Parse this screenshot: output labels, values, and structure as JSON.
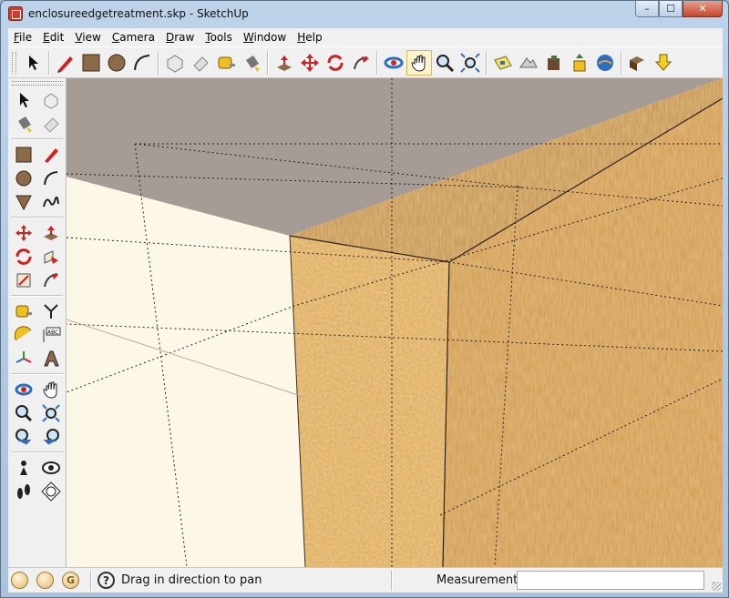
{
  "window": {
    "title": "enclosureedgetreatment.skp - SketchUp",
    "minimize_glyph": "–",
    "maximize_glyph": "☐",
    "close_glyph": "✕"
  },
  "menu": {
    "items": [
      {
        "label": "File",
        "mnemonic": "F"
      },
      {
        "label": "Edit",
        "mnemonic": "E"
      },
      {
        "label": "View",
        "mnemonic": "V"
      },
      {
        "label": "Camera",
        "mnemonic": "C"
      },
      {
        "label": "Draw",
        "mnemonic": "D"
      },
      {
        "label": "Tools",
        "mnemonic": "T"
      },
      {
        "label": "Window",
        "mnemonic": "W"
      },
      {
        "label": "Help",
        "mnemonic": "H"
      }
    ]
  },
  "toolbar": {
    "icons": [
      "select-icon",
      "pencil-line-icon",
      "rectangle-icon",
      "circle-icon",
      "arc-icon",
      "make-component-icon",
      "eraser-icon",
      "tape-measure-icon",
      "paint-bucket-icon",
      "push-pull-icon",
      "move-icon",
      "rotate-icon",
      "follow-me-icon",
      "orbit-icon",
      "pan-icon",
      "zoom-icon",
      "zoom-extents-icon",
      "add-location-icon",
      "toggle-terrain-icon",
      "get-models-icon",
      "share-model-icon",
      "google-earth-icon",
      "components-icon",
      "export-icon"
    ],
    "active": "pan-icon"
  },
  "left_toolbar": {
    "icons": [
      "select-icon",
      "make-component-icon",
      "paint-bucket-icon",
      "eraser-icon",
      "rectangle-icon",
      "line-icon",
      "circle-icon",
      "arc-icon",
      "polygon-icon",
      "freehand-icon",
      "move-icon",
      "push-pull-icon",
      "rotate-icon",
      "follow-me-icon",
      "scale-icon",
      "offset-icon",
      "tape-measure-icon",
      "dimension-icon",
      "protractor-icon",
      "text-icon",
      "axes-icon",
      "3d-text-icon",
      "orbit-icon",
      "pan-icon",
      "zoom-icon",
      "zoom-window-icon",
      "previous-view-icon",
      "next-view-icon",
      "position-camera-icon",
      "look-around-icon",
      "walk-icon",
      "section-plane-icon"
    ],
    "active": "pan-icon"
  },
  "status": {
    "message": "Drag in direction to pan",
    "measurements_label": "Measurements",
    "measurements_value": "",
    "geo_badge_letter": "G",
    "help_glyph": "?"
  },
  "colors": {
    "sky_gray": "#9f9890",
    "wood": "#d9a45a",
    "background": "#fdf7e8",
    "pan_highlight": "#fff3c8"
  }
}
